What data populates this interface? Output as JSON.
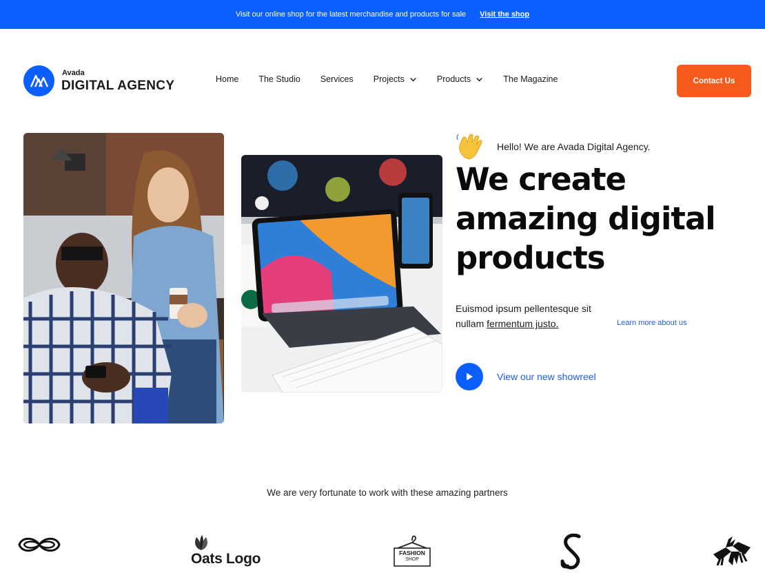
{
  "banner": {
    "text": "Visit our online shop for the latest merchandise and products for sale",
    "link": "Visit the shop"
  },
  "brand": {
    "small": "Avada",
    "big": "DIGITAL AGENCY"
  },
  "nav": [
    {
      "label": "Home",
      "dropdown": false
    },
    {
      "label": "The Studio",
      "dropdown": false
    },
    {
      "label": "Services",
      "dropdown": false
    },
    {
      "label": "Projects",
      "dropdown": true
    },
    {
      "label": "Products",
      "dropdown": true
    },
    {
      "label": "The Magazine",
      "dropdown": false
    }
  ],
  "contact_button": "Contact Us",
  "hero": {
    "hello": "Hello! We are Avada Digital Agency.",
    "headline_lines": [
      "We create",
      "amazing digital",
      "products"
    ],
    "desc_text": "Euismod ipsum pellentesque sit nullam",
    "desc_link": "fermentum justo.",
    "learn_more": "Learn more about us",
    "showreel": "View our new showreel"
  },
  "partners": {
    "title": "We are very fortunate to work with these amazing partners",
    "oats_label": "Oats Logo",
    "fashion_line1": "FASHION",
    "fashion_line2": "SHOP"
  },
  "colors": {
    "brand_blue": "#0b5fff",
    "accent_orange": "#f55b1d",
    "link_blue": "#1d5ee0"
  }
}
